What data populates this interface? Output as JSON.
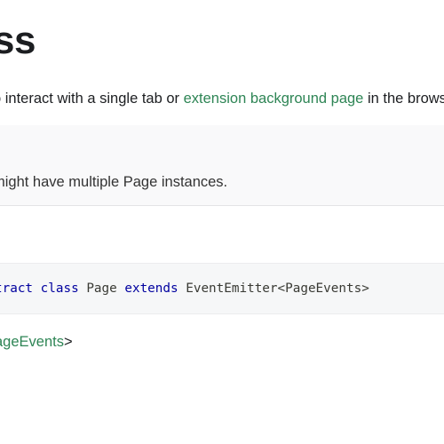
{
  "header": {
    "title": "ss"
  },
  "intro": {
    "text_before": "o interact with a single tab or ",
    "link": "extension background page",
    "text_after": " in the brows"
  },
  "remark": {
    "text": "might have multiple Page instances."
  },
  "signature": {
    "kw_abstract": "tract",
    "kw_class": "class",
    "class_name": "Page",
    "kw_extends": "extends",
    "base_type": "EventEmitter<PageEvents>"
  },
  "extends_info": {
    "link": "ageEvents",
    "suffix": ">"
  }
}
